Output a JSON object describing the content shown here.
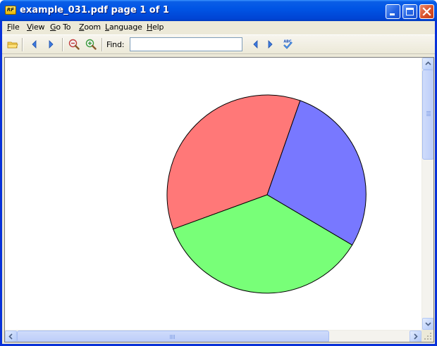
{
  "window": {
    "title": "example_031.pdf page 1 of 1",
    "app_icon": "pdf-viewer-app-icon",
    "app_icon_text": "RF"
  },
  "menu": [
    {
      "mnemonic": "F",
      "rest": "ile"
    },
    {
      "mnemonic": "V",
      "rest": "iew"
    },
    {
      "mnemonic": "G",
      "rest": "o To"
    },
    {
      "mnemonic": "Z",
      "rest": "oom"
    },
    {
      "mnemonic": "L",
      "rest": "anguage"
    },
    {
      "mnemonic": "H",
      "rest": "elp"
    }
  ],
  "toolbar": {
    "icons": [
      "open-folder-icon",
      "previous-page-icon",
      "next-page-icon",
      "zoom-out-icon",
      "zoom-in-icon",
      "find-previous-icon",
      "find-next-icon",
      "spellcheck-icon"
    ],
    "find_label": "Find:",
    "find_value": "",
    "find_placeholder": ""
  },
  "document": {
    "content": "pie-chart",
    "slices": [
      {
        "name": "red-slice",
        "color": "#ff7878"
      },
      {
        "name": "blue-slice",
        "color": "#7878ff"
      },
      {
        "name": "green-slice",
        "color": "#78ff78"
      }
    ]
  },
  "colors": {
    "titlebar": "#0055e5",
    "chrome": "#ece9d8",
    "close_button": "#d9512a"
  }
}
